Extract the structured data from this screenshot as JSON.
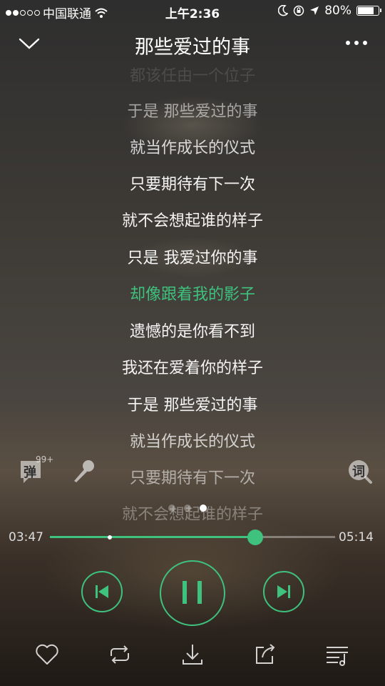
{
  "status_bar": {
    "carrier": "中国联通",
    "time": "上午2:36",
    "battery": "80%",
    "battery_level": 0.8,
    "icons": [
      "signal-dots-icon",
      "wifi-icon",
      "moon-icon",
      "rotation-lock-icon",
      "location-arrow-icon",
      "battery-icon"
    ]
  },
  "header": {
    "title": "那些爱过的事",
    "icons": [
      "chevron-down-icon",
      "more-icon"
    ]
  },
  "lyrics": {
    "lines": [
      "都该任由一个位子",
      "于是 那些爱过的事",
      "就当作成长的仪式",
      "只要期待有下一次",
      "就不会想起谁的样子",
      "只是 我爱过你的事",
      "却像跟着我的影子",
      "遗憾的是你看不到",
      "我还在爱着你的样子",
      "于是 那些爱过的事",
      "就当作成长的仪式",
      "只要期待有下一次",
      "就不会想起谁的样子"
    ],
    "active_index": 6,
    "active_color": "#3ec27e"
  },
  "tools": {
    "danmaku_label": "弹",
    "danmaku_badge": "99+",
    "lyrics_label": "词",
    "icons": [
      "danmaku-icon",
      "microphone-icon",
      "lyrics-search-icon"
    ]
  },
  "pager": {
    "count": 3,
    "current": 2
  },
  "progress": {
    "elapsed": "03:47",
    "total": "05:14",
    "fraction": 0.72,
    "marker_fraction": 0.21
  },
  "controls": {
    "icons": [
      "previous-icon",
      "pause-icon",
      "next-icon"
    ]
  },
  "bottom_bar": {
    "icons": [
      "heart-icon",
      "repeat-icon",
      "download-icon",
      "share-icon",
      "playlist-icon"
    ]
  },
  "accent_color": "#3ec27e"
}
